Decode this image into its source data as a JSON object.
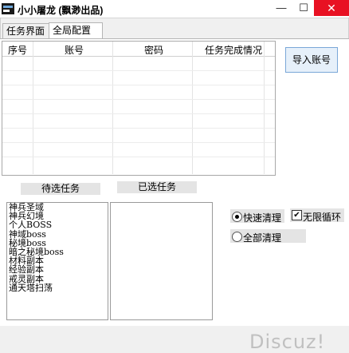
{
  "window": {
    "title": "小小屠龙 (飘渺出品)",
    "icon": "app-icon"
  },
  "tabs": [
    {
      "label": "任务界面"
    },
    {
      "label": "全局配置"
    }
  ],
  "grid": {
    "columns": [
      "序号",
      "账号",
      "密码",
      "任务完成情况"
    ],
    "rows": []
  },
  "buttons": {
    "import": "导入账号"
  },
  "labels": {
    "pending": "待选任务",
    "selected": "已选任务"
  },
  "pending_tasks": [
    "神兵圣域",
    "神兵幻境",
    "个人BOSS",
    "神域boss",
    "秘境boss",
    "暗之秘境boss",
    "材料副本",
    "经验副本",
    "戒灵副本",
    "通天塔扫荡"
  ],
  "selected_tasks": [],
  "options": {
    "fast_clear": "快速清理",
    "all_clear": "全部清理",
    "infinite_loop": "无限循环",
    "fast_clear_checked": true,
    "infinite_loop_checked": true
  },
  "watermark": "Discuz!"
}
